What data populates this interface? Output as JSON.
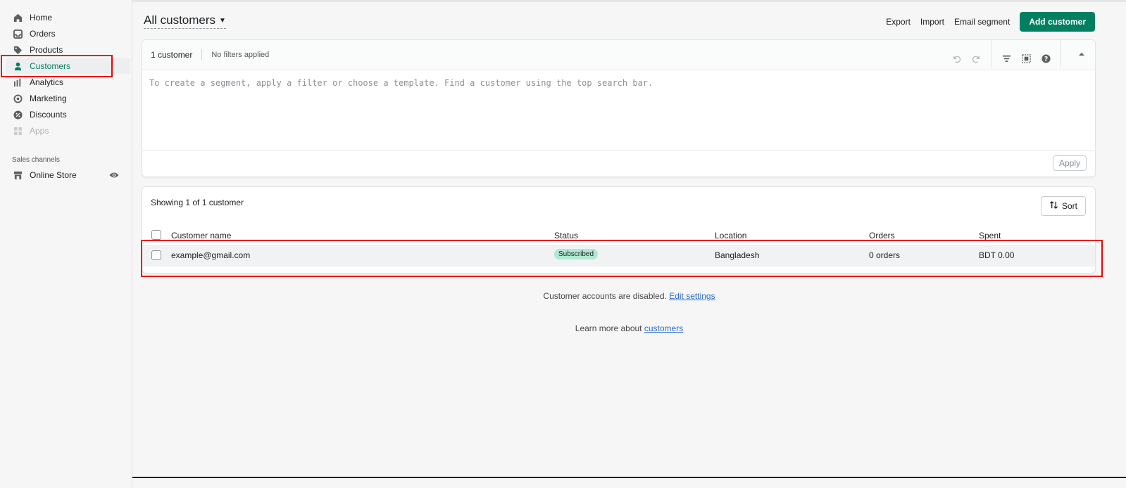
{
  "sidebar": {
    "items": [
      {
        "label": "Home",
        "icon": "home-icon"
      },
      {
        "label": "Orders",
        "icon": "inbox-icon"
      },
      {
        "label": "Products",
        "icon": "tag-icon"
      },
      {
        "label": "Customers",
        "icon": "person-icon",
        "active": true
      },
      {
        "label": "Analytics",
        "icon": "bar-chart-icon"
      },
      {
        "label": "Marketing",
        "icon": "target-icon"
      },
      {
        "label": "Discounts",
        "icon": "discount-icon"
      },
      {
        "label": "Apps",
        "icon": "apps-icon",
        "disabled": true
      }
    ],
    "sales_channels_title": "Sales channels",
    "channels": [
      {
        "label": "Online Store",
        "icon": "store-icon"
      }
    ]
  },
  "header": {
    "title": "All customers",
    "actions": {
      "export": "Export",
      "import": "Import",
      "email_segment": "Email segment",
      "add_customer": "Add customer"
    }
  },
  "segment": {
    "count": "1 customer",
    "filters": "No filters applied",
    "placeholder": "To create a segment, apply a filter or choose a template. Find a customer using the top search bar.",
    "apply": "Apply"
  },
  "list": {
    "showing": "Showing 1 of 1 customer",
    "sort": "Sort",
    "columns": [
      "Customer name",
      "Status",
      "Location",
      "Orders",
      "Spent"
    ],
    "rows": [
      {
        "name": "example@gmail.com",
        "status": "Subscribed",
        "location": "Bangladesh",
        "orders": "0 orders",
        "spent": "BDT 0.00"
      }
    ]
  },
  "footer": {
    "accounts_text": "Customer accounts are disabled.",
    "accounts_link": "Edit settings",
    "learn_text": "Learn more about",
    "learn_link": "customers"
  },
  "colors": {
    "accent": "#008060",
    "active_text": "#007f5f",
    "badge": "#aee9d1",
    "highlight": "#ee0000",
    "link": "#2c6ecb"
  }
}
